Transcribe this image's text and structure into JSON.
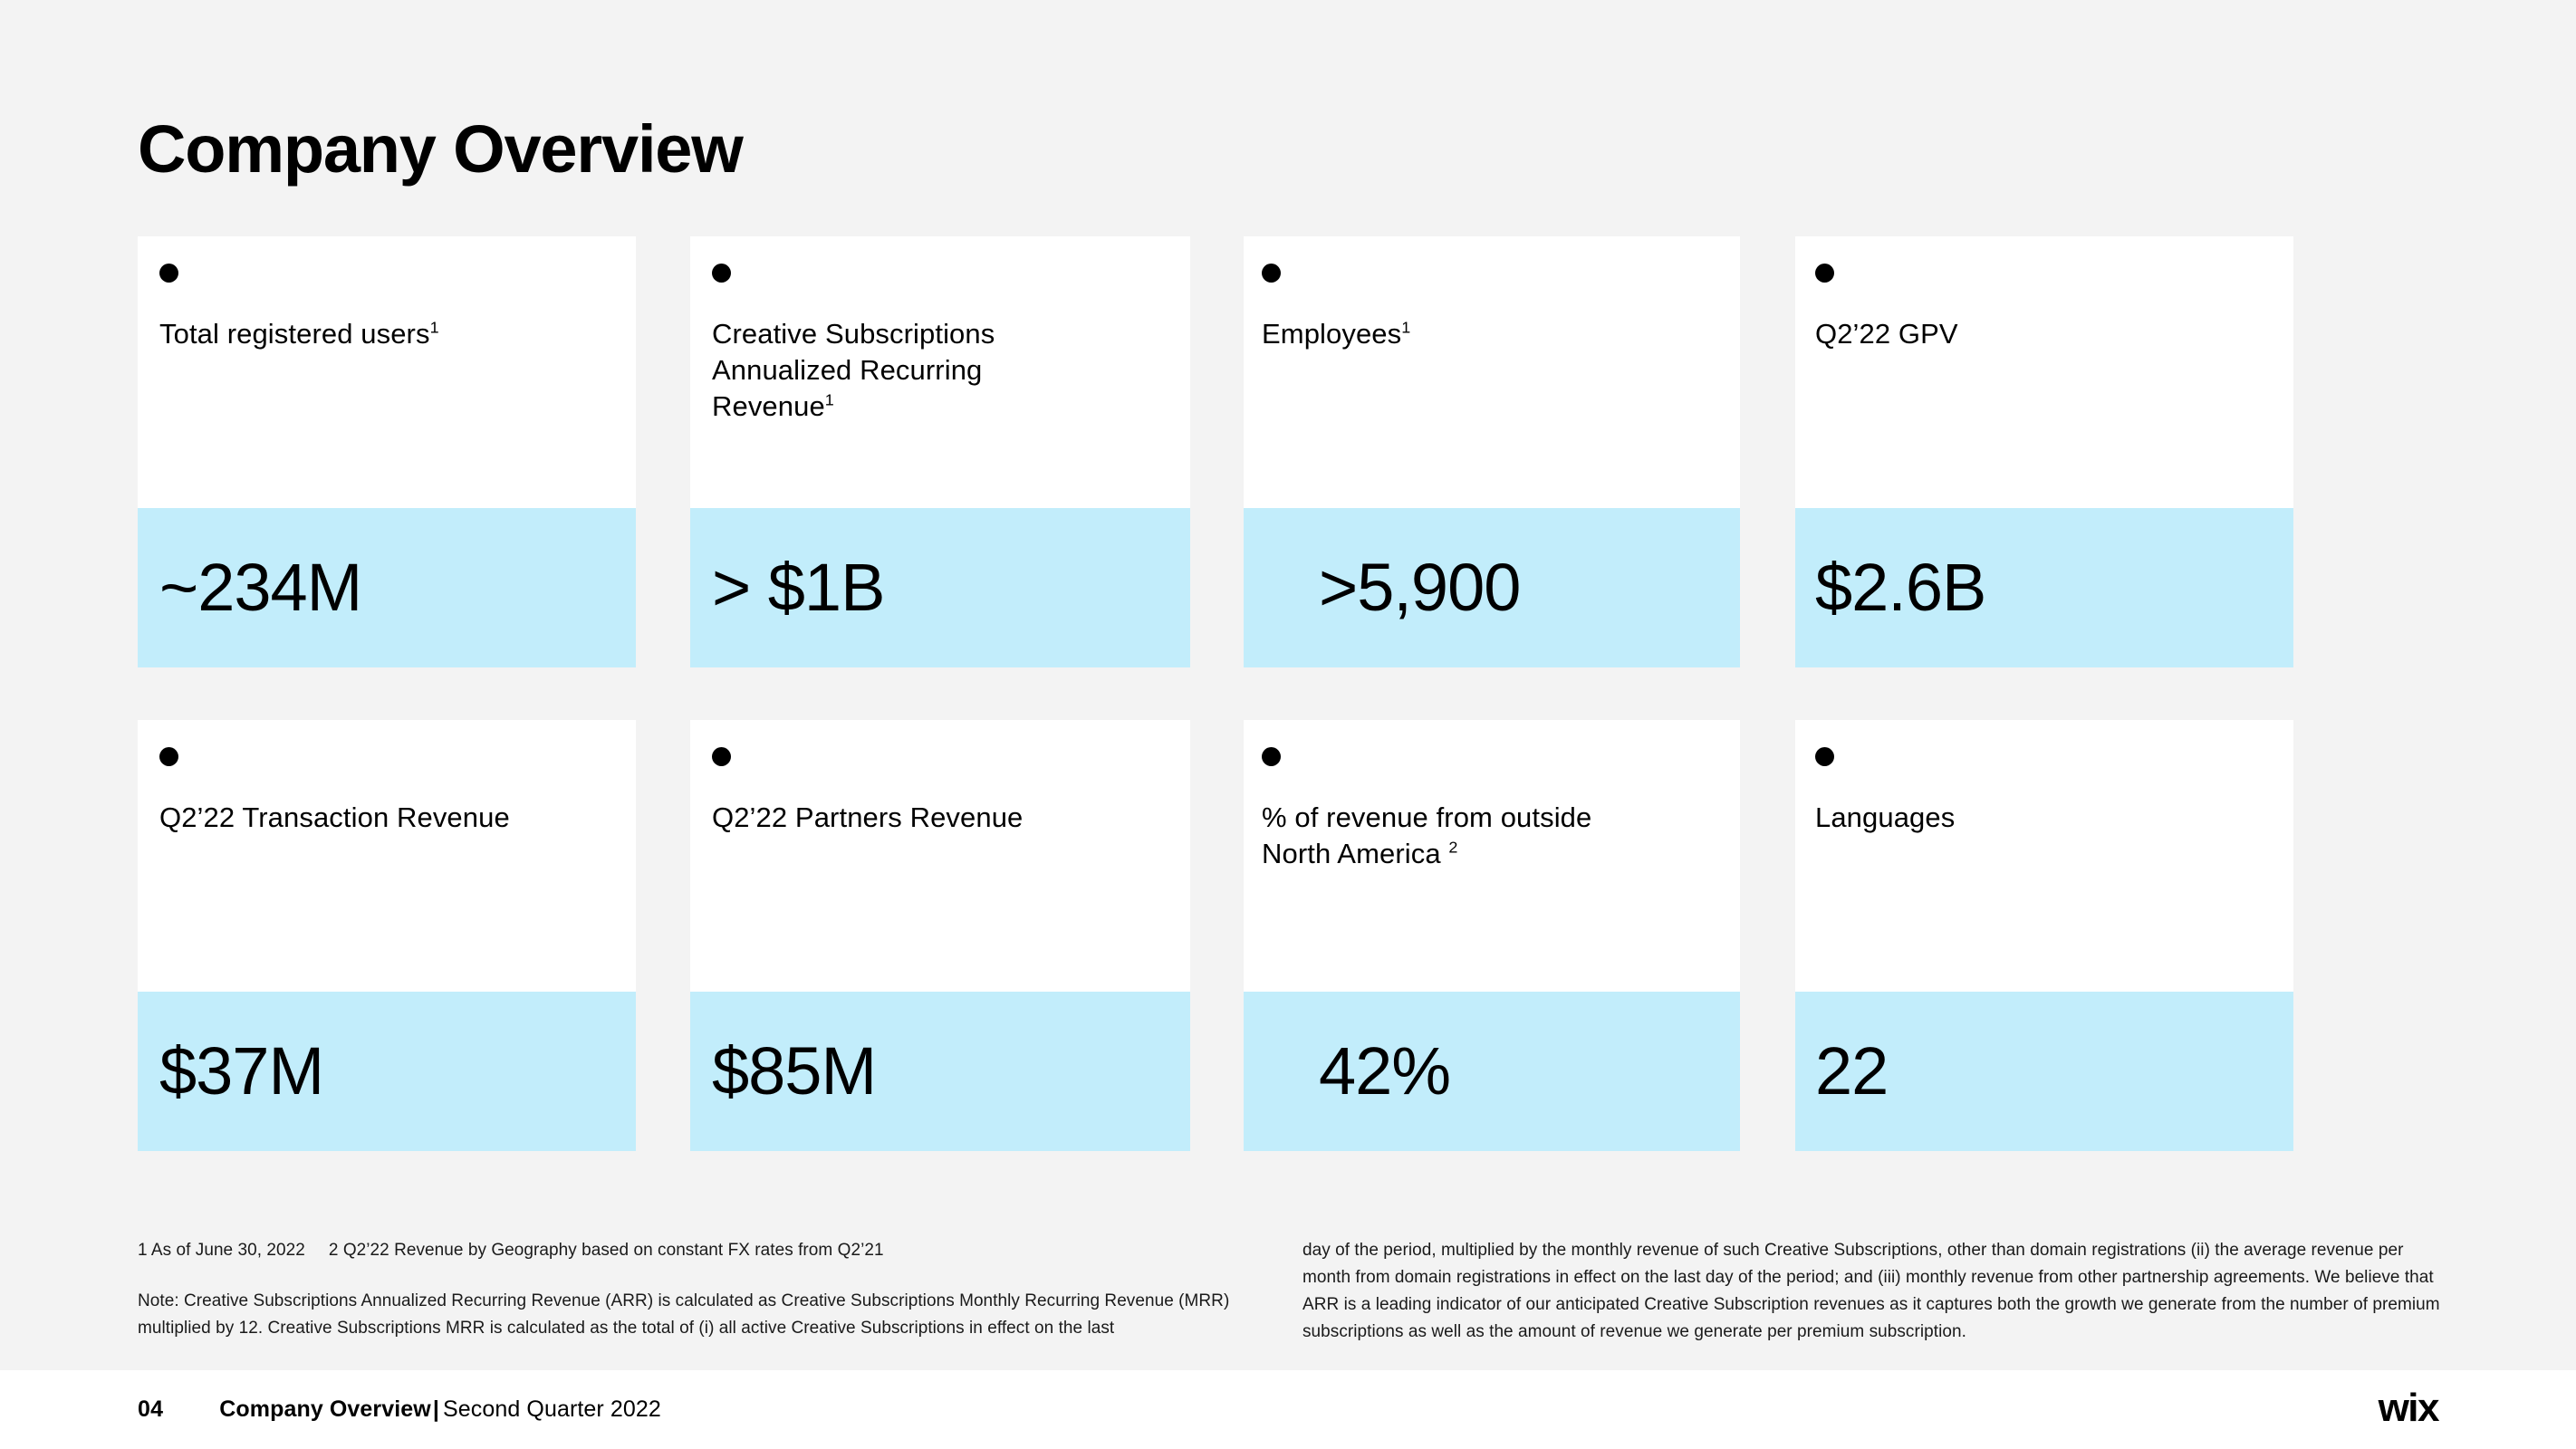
{
  "page_title": "Company Overview",
  "colors": {
    "slide_background": "#f3f3f3",
    "card_background": "#ffffff",
    "value_band": "#c2edfb",
    "text": "#000000"
  },
  "cards": [
    {
      "label_lines": [
        "Total registered users"
      ],
      "label_superscript": "1",
      "value": "~234M"
    },
    {
      "label_lines": [
        "Creative Subscriptions",
        "Annualized Recurring",
        "Revenue"
      ],
      "label_superscript": "1",
      "value": "> $1B"
    },
    {
      "label_lines": [
        "Employees"
      ],
      "label_superscript": "1",
      "value": ">5,900"
    },
    {
      "label_lines": [
        "Q2’22 GPV"
      ],
      "label_superscript": "",
      "value": "$2.6B"
    },
    {
      "label_lines": [
        "Q2’22 Transaction Revenue"
      ],
      "label_superscript": "",
      "value": "$37M"
    },
    {
      "label_lines": [
        "Q2’22 Partners Revenue"
      ],
      "label_superscript": "",
      "value": "$85M"
    },
    {
      "label_lines": [
        "% of revenue from outside",
        "North America "
      ],
      "label_superscript": "2",
      "value": "42%"
    },
    {
      "label_lines": [
        "Languages"
      ],
      "label_superscript": "",
      "value": "22"
    }
  ],
  "footnotes": {
    "left_top_a": "1 As of June 30, 2022",
    "left_top_b": "2 Q2’22 Revenue by Geography based on constant FX rates from Q2’21",
    "left_note": "Note: Creative Subscriptions Annualized Recurring Revenue (ARR) is calculated as Creative Subscriptions Monthly Recurring Revenue (MRR) multiplied by 12. Creative Subscriptions MRR is calculated as the total of (i) all active Creative Subscriptions in effect on the last",
    "right_note": "day of the period, multiplied by the monthly revenue of such Creative Subscriptions, other than domain registrations (ii) the average revenue per month from domain registrations in effect on the last day of the period; and (iii) monthly revenue from other partnership agreements. We believe that ARR is a leading indicator of our anticipated Creative Subscription revenues as it captures both the growth we generate from the number of premium subscriptions as well as the amount of revenue we generate per premium subscription."
  },
  "footer": {
    "page_number": "04",
    "crumb_bold": "Company Overview",
    "crumb_separator": "|",
    "crumb_rest": "Second Quarter 2022",
    "logo": "wix"
  }
}
